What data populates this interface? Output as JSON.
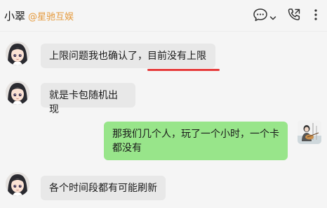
{
  "header": {
    "contact_name": "小翠",
    "contact_org": "@星驰互娱"
  },
  "messages": [
    {
      "direction": "in",
      "text": "上限问题我也确认了，目前没有上限"
    },
    {
      "direction": "in",
      "text": "就是卡包随机出现"
    },
    {
      "direction": "out",
      "text": "那我们几个人，玩了一个小时，一个卡都没有"
    },
    {
      "direction": "in",
      "text": "各个时间段都有可能刷新"
    }
  ],
  "colors": {
    "incoming_bubble": "#e8e8e8",
    "outgoing_bubble": "#98e58a",
    "org_label": "#e59a3d",
    "highlight": "#e63b3b"
  },
  "icons": [
    "chat-icon",
    "chevron-down-icon",
    "phone-call-icon",
    "more-icon",
    "avatar"
  ]
}
